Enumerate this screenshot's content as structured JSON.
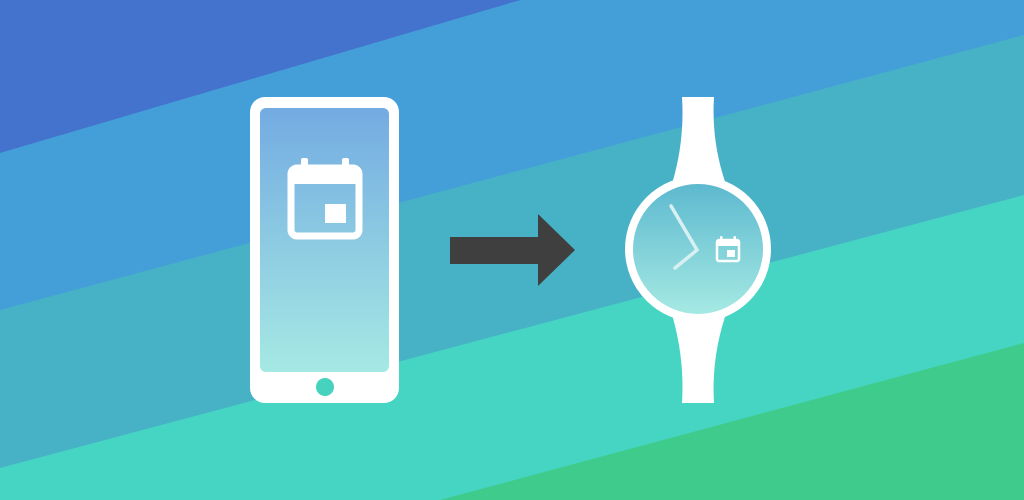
{
  "colors": {
    "band_1": "#4473CE",
    "band_2": "#449FD9",
    "band_3": "#47B2C6",
    "band_4": "#45D5C2",
    "band_5": "#3FCB8C",
    "device_outline": "#FFFFFF",
    "screen_gradient_top": "#73ABE2",
    "screen_gradient_bottom": "#A5E9E3",
    "home_button": "#47D2BD",
    "arrow": "#3F3F3F"
  },
  "icons": {
    "phone": "smartphone-icon",
    "phone_calendar": "calendar-icon",
    "arrow": "arrow-right-icon",
    "watch": "smartwatch-icon",
    "watch_calendar": "calendar-icon"
  }
}
